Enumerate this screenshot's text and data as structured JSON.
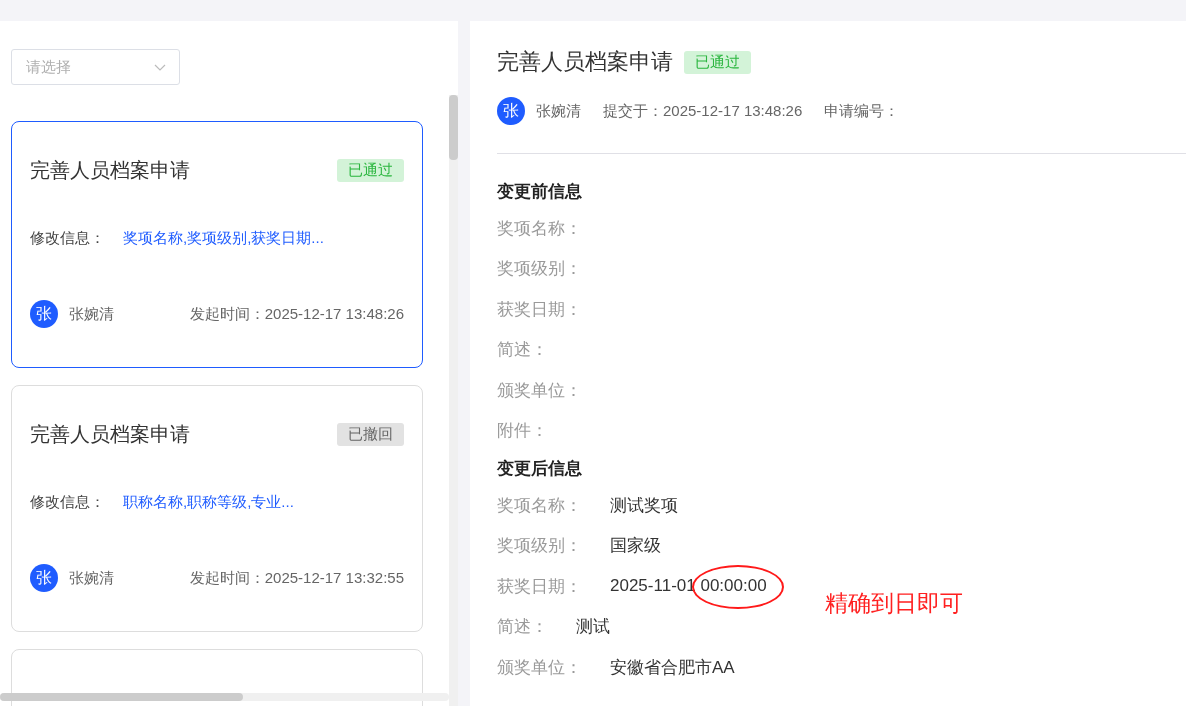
{
  "filter": {
    "placeholder": "请选择"
  },
  "applications": [
    {
      "title": "完善人员档案申请",
      "status": {
        "label": "已通过",
        "kind": "approved"
      },
      "selected": true,
      "info_label": "修改信息：",
      "info_value": "奖项名称,奖项级别,获奖日期...",
      "avatar": "张",
      "name": "张婉清",
      "time": "发起时间：2025-12-17 13:48:26"
    },
    {
      "title": "完善人员档案申请",
      "status": {
        "label": "已撤回",
        "kind": "withdrawn"
      },
      "selected": false,
      "info_label": "修改信息：",
      "info_value": "职称名称,职称等级,专业...",
      "avatar": "张",
      "name": "张婉清",
      "time": "发起时间：2025-12-17 13:32:55"
    },
    {
      "selected": false
    }
  ],
  "detail": {
    "title": "完善人员档案申请",
    "status": {
      "label": "已通过",
      "kind": "approved"
    },
    "avatar": "张",
    "name": "张婉清",
    "submitted": "提交于：2025-12-17 13:48:26",
    "number_label": "申请编号：",
    "sections": [
      {
        "heading": "变更前信息",
        "fields": [
          {
            "label": "奖项名称："
          },
          {
            "label": "奖项级别："
          },
          {
            "label": "获奖日期："
          },
          {
            "label": "简述："
          },
          {
            "label": "颁奖单位："
          },
          {
            "label": "附件："
          }
        ]
      },
      {
        "heading": "变更后信息",
        "fields": [
          {
            "label": "奖项名称：",
            "value": "测试奖项"
          },
          {
            "label": "奖项级别：",
            "value": "国家级"
          },
          {
            "label": "获奖日期：",
            "value": "2025-11-01 00:00:00",
            "circled": true,
            "note": "精确到日即可"
          },
          {
            "label": "简述：",
            "value": "测试"
          },
          {
            "label": "颁奖单位：",
            "value": "安徽省合肥市AA"
          }
        ]
      }
    ]
  }
}
